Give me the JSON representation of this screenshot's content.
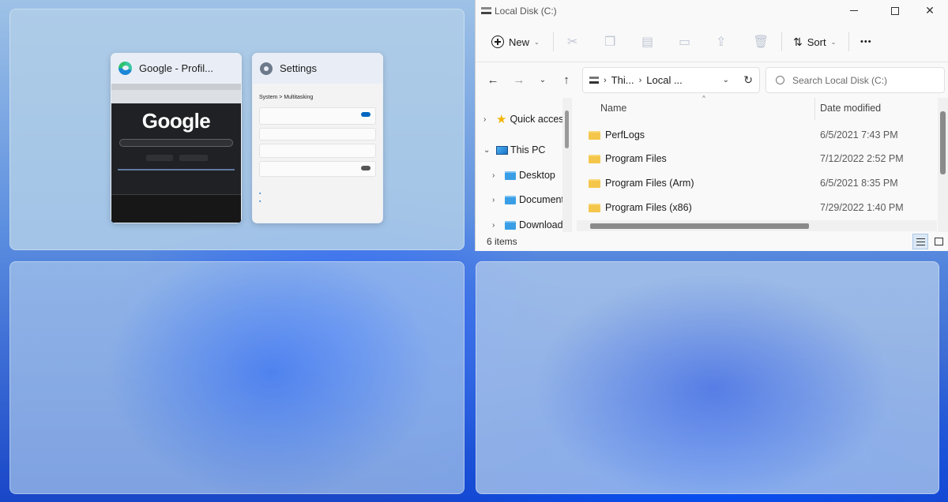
{
  "snap_assist": {
    "thumbnails": [
      {
        "title": "Google - Profil...",
        "icon": "edge-icon"
      },
      {
        "title": "Settings",
        "icon": "settings-gear-icon"
      }
    ],
    "google_preview": {
      "logo": "Google"
    },
    "settings_preview": {
      "breadcrumb": "System  >  Multitasking"
    }
  },
  "explorer": {
    "title": "Local Disk (C:)",
    "toolbar": {
      "new_label": "New",
      "sort_label": "Sort",
      "more_label": "•••"
    },
    "address": {
      "crumbs": [
        "Thi...",
        "Local ..."
      ]
    },
    "search": {
      "placeholder": "Search Local Disk (C:)"
    },
    "nav_tree": [
      {
        "label": "Quick access",
        "icon": "star-icon"
      },
      {
        "label": "This PC",
        "icon": "computer-icon"
      },
      {
        "label": "Desktop",
        "icon": "folder-icon"
      },
      {
        "label": "Documents",
        "icon": "folder-icon"
      },
      {
        "label": "Downloads",
        "icon": "folder-icon"
      }
    ],
    "columns": [
      "Name",
      "Date modified"
    ],
    "files": [
      {
        "name": "PerfLogs",
        "date": "6/5/2021 7:43 PM"
      },
      {
        "name": "Program Files",
        "date": "7/12/2022 2:52 PM"
      },
      {
        "name": "Program Files (Arm)",
        "date": "6/5/2021 8:35 PM"
      },
      {
        "name": "Program Files (x86)",
        "date": "7/29/2022 1:40 PM"
      }
    ],
    "status": {
      "item_count": "6 items"
    }
  }
}
